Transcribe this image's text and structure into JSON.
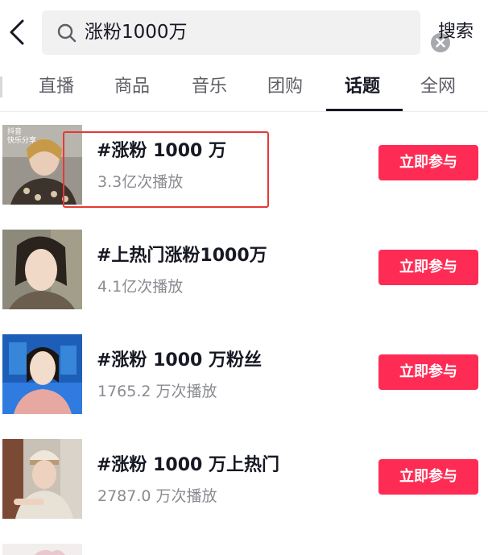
{
  "search": {
    "query": "涨粉1000万",
    "button_label": "搜索"
  },
  "tabs": [
    {
      "label": "直播"
    },
    {
      "label": "商品"
    },
    {
      "label": "音乐"
    },
    {
      "label": "团购"
    },
    {
      "label": "话题"
    },
    {
      "label": "全网"
    }
  ],
  "active_tab": "话题",
  "topics": [
    {
      "title": "#涨粉 1000 万",
      "plays": "3.3亿次播放",
      "button": "立即参与",
      "thumb_text": "抖音\n快乐分享"
    },
    {
      "title": "#上热门涨粉1000万",
      "plays": "4.1亿次播放",
      "button": "立即参与"
    },
    {
      "title": "#涨粉 1000 万粉丝",
      "plays": "1765.2 万次播放",
      "button": "立即参与"
    },
    {
      "title": "#涨粉 1000 万上热门",
      "plays": "2787.0 万次播放",
      "button": "立即参与"
    }
  ],
  "colors": {
    "accent": "#fe2c55",
    "highlight": "#e53935",
    "text_primary": "#161823",
    "text_secondary": "#8a8b91",
    "search_bg": "#f1f1f2"
  }
}
